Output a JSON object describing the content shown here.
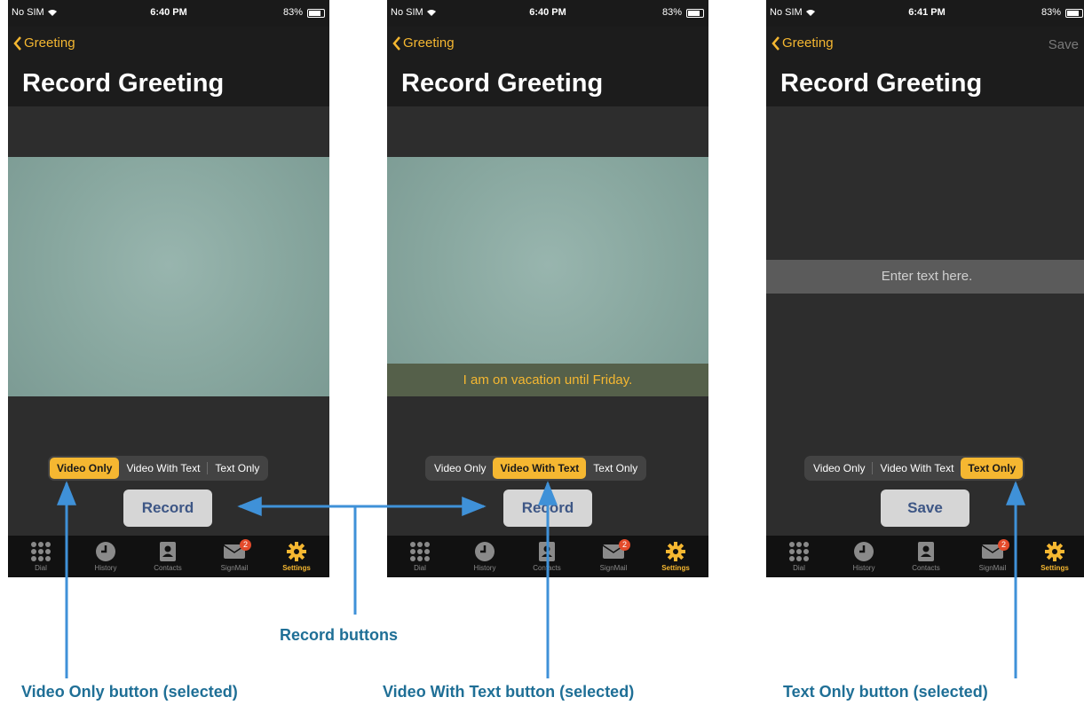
{
  "status": {
    "carrier": "No SIM",
    "battery": "83%",
    "times": [
      "6:40 PM",
      "6:40 PM",
      "6:41 PM"
    ]
  },
  "nav": {
    "back_label": "Greeting",
    "save_label": "Save",
    "title": "Record Greeting"
  },
  "segments": [
    "Video Only",
    "Video With Text",
    "Text Only"
  ],
  "screens": {
    "video_only": {
      "selected": "Video Only",
      "action": "Record"
    },
    "video_with_text": {
      "selected": "Video With Text",
      "action": "Record",
      "caption": "I am on vacation until Friday."
    },
    "text_only": {
      "selected": "Text Only",
      "action": "Save",
      "placeholder": "Enter text here."
    }
  },
  "tabs": [
    "Dial",
    "History",
    "Contacts",
    "SignMail",
    "Settings"
  ],
  "signmail_badge": "2",
  "callouts": {
    "record_buttons": "Record buttons",
    "video_only": "Video Only button (selected)",
    "video_with_text": "Video With Text button (selected)",
    "text_only": "Text Only button (selected)"
  },
  "colors": {
    "accent": "#f5b731",
    "callout": "#1f6f96",
    "arrow": "#3f91d8"
  }
}
